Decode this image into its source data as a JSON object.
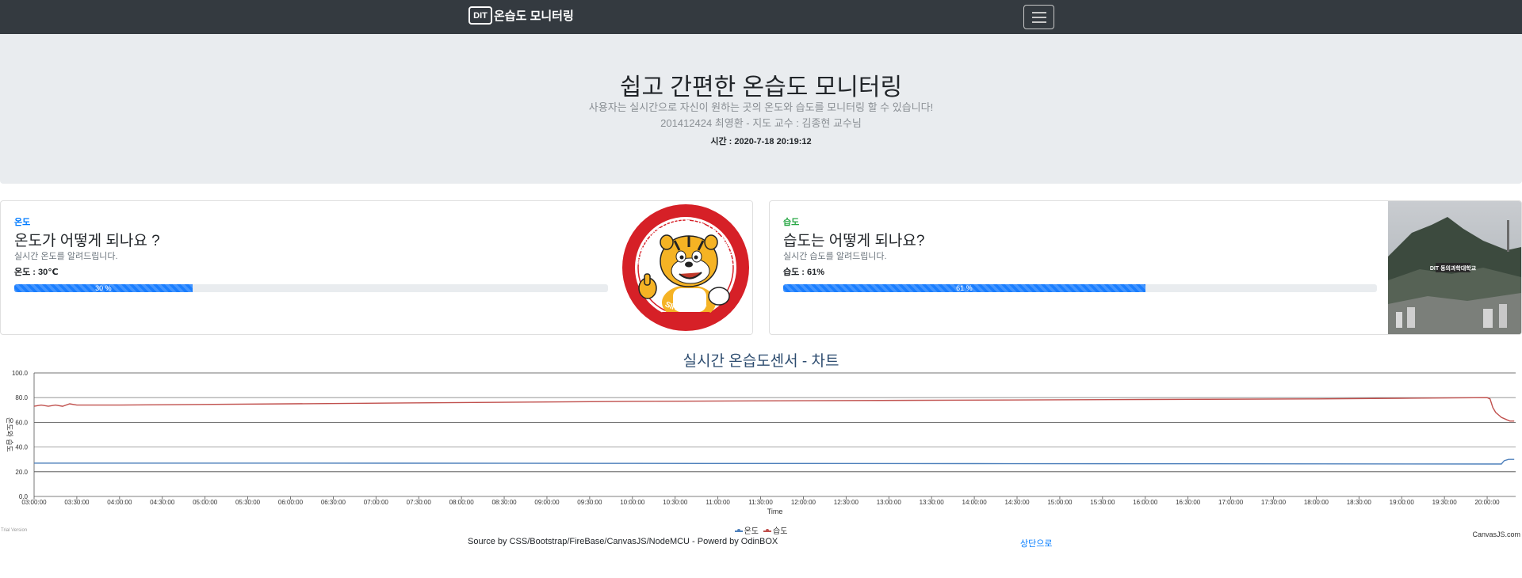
{
  "navbar": {
    "logo_text": "DIT",
    "brand": "온습도 모니터링"
  },
  "jumbotron": {
    "title": "쉽고 간편한 온습도 모니터링",
    "lead1": "사용자는 실시간으로 자신이 원하는 곳의 온도와 습도를 모니터링 할 수 있습니다!",
    "lead2": "201412424 최영환 - 지도 교수 : 김종현 교수님",
    "time": "시간 : 2020-7-18 20:19:12"
  },
  "cards": {
    "temp": {
      "category": "온도",
      "category_color": "#007bff",
      "title": "온도가 어떻게 되나요 ?",
      "desc": "실시간 온도를 알려드립니다.",
      "value": "온도 : 30℃",
      "progress": 30,
      "progress_label": "30 %",
      "image_text_top": "DONGEUI INSTITUTE OF TECHNOLOGY",
      "image_text_bottom": "SINCE 1972"
    },
    "humid": {
      "category": "습도",
      "category_color": "#28a745",
      "title": "습도는 어떻게 되나요?",
      "desc": "실시간 습도를 알려드립니다.",
      "value": "습도 : 61%",
      "progress": 61,
      "progress_label": "61 %",
      "image_sign": "DIT 동의과학대학교"
    }
  },
  "chart_title": "실시간 온습도센서 - 차트",
  "chart_data": {
    "type": "line",
    "xlabel": "Time",
    "ylabel": "온도와 습도",
    "ylim": [
      0,
      100
    ],
    "yticks": [
      "0.0",
      "20.0",
      "40.0",
      "60.0",
      "80.0",
      "100.0"
    ],
    "xticks": [
      "03:00:00",
      "03:30:00",
      "04:00:00",
      "04:30:00",
      "05:00:00",
      "05:30:00",
      "06:00:00",
      "06:30:00",
      "07:00:00",
      "07:30:00",
      "08:00:00",
      "08:30:00",
      "09:00:00",
      "09:30:00",
      "10:00:00",
      "10:30:00",
      "11:00:00",
      "11:30:00",
      "12:00:00",
      "12:30:00",
      "13:00:00",
      "13:30:00",
      "14:00:00",
      "14:30:00",
      "15:00:00",
      "15:30:00",
      "16:00:00",
      "16:30:00",
      "17:00:00",
      "17:30:00",
      "18:00:00",
      "18:30:00",
      "19:00:00",
      "19:30:00",
      "20:00:00"
    ],
    "series": [
      {
        "name": "온도",
        "color": "#4f81bc",
        "x": [
          "03:00:00",
          "06:00:00",
          "10:00:00",
          "14:00:00",
          "18:00:00",
          "20:00:00",
          "20:10:00",
          "20:12:00",
          "20:15:00",
          "20:19:00"
        ],
        "values": [
          27,
          27,
          26.8,
          26.6,
          26.4,
          26.3,
          26.3,
          29,
          30,
          30
        ]
      },
      {
        "name": "습도",
        "color": "#c0504d",
        "x": [
          "03:00:00",
          "03:05:00",
          "03:10:00",
          "03:15:00",
          "03:20:00",
          "03:25:00",
          "03:30:00",
          "03:35:00",
          "04:00:00",
          "06:00:00",
          "08:00:00",
          "10:00:00",
          "12:00:00",
          "14:00:00",
          "16:00:00",
          "18:00:00",
          "19:00:00",
          "20:00:00",
          "20:02:00",
          "20:04:00",
          "20:06:00",
          "20:08:00",
          "20:10:00",
          "20:12:00",
          "20:14:00",
          "20:16:00",
          "20:19:00"
        ],
        "values": [
          73,
          74,
          73,
          74,
          73,
          75,
          74,
          74,
          74,
          75,
          76,
          77,
          77.5,
          78,
          78.5,
          79,
          79.5,
          80,
          79,
          72,
          68,
          66,
          64,
          63,
          62,
          61,
          61
        ]
      }
    ],
    "legend": "bottom-center"
  },
  "chart_extra": {
    "trial_text": "Trial Version",
    "credit_text": "CanvasJS.com"
  },
  "footer": {
    "text": "Source by CSS/Bootstrap/FireBase/CanvasJS/NodeMCU - Powerd by OdinBOX",
    "back_to_top": "상단으로"
  }
}
